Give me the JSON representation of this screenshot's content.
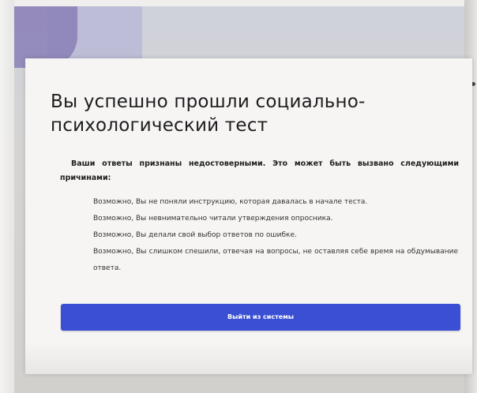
{
  "result_card": {
    "title": "Вы успешно прошли социально-психологический тест",
    "intro": "Ваши ответы признаны недостоверными. Это может быть вызвано следующими причинами:",
    "reasons": [
      "Возможно, Вы не поняли инструкцию, которая давалась в начале теста.",
      "Возможно, Вы невнимательно читали утверждения опросника.",
      "Возможно, Вы делали свой выбор ответов по ошибке.",
      "Возможно, Вы слишком спешили, отвечая на вопросы, не оставляя себе время на обдумывание ответа."
    ],
    "logout_label": "Выйти из системы"
  },
  "colors": {
    "button": "#3a4fd3",
    "accent_purple": "#8a7fb6"
  }
}
